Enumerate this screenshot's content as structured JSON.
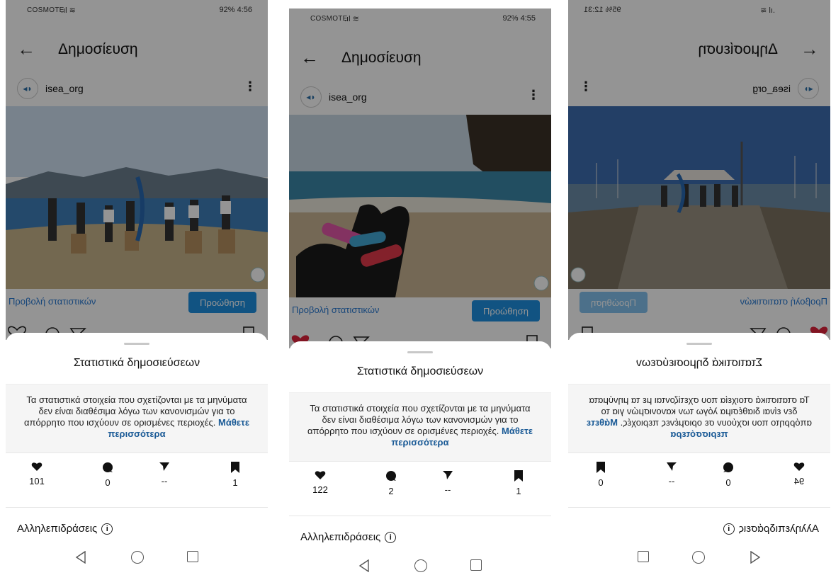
{
  "screens": [
    {
      "status": {
        "carrier": "COSMOTE",
        "right": "92% 4:56"
      },
      "appbar_title": "Δημοσίευση",
      "username": "isea_org",
      "view_stats": "Προβολή στατιστικών",
      "promote": "Προώθηση",
      "sheet_title": "Στατιστικά δημοσιεύσεων",
      "notice": "Τα στατιστικά στοιχεία που σχετίζονται με τα μηνύματα δεν είναι διαθέσιμα λόγω των κανονισμών για το απόρρητο που ισχύουν σε ορισμένες περιοχές.",
      "learn_more": "Μάθετε περισσότερα",
      "likes": "101",
      "comments": "0",
      "shares": "--",
      "saves": "1",
      "interactions": "Αλληλεπιδράσεις",
      "info_glyph": "i"
    },
    {
      "status": {
        "carrier": "COSMOTE",
        "right": "92% 4:55"
      },
      "appbar_title": "Δημοσίευση",
      "username": "isea_org",
      "view_stats": "Προβολή στατιστικών",
      "promote": "Προώθηση",
      "sheet_title": "Στατιστικά δημοσιεύσεων",
      "notice": "Τα στατιστικά στοιχεία που σχετίζονται με τα μηνύματα δεν είναι διαθέσιμα λόγω των κανονισμών για το απόρρητο που ισχύουν σε ορισμένες περιοχές.",
      "learn_more": "Μάθετε περισσότερα",
      "likes": "122",
      "comments": "2",
      "shares": "--",
      "saves": "1",
      "interactions": "Αλληλεπιδράσεις",
      "info_glyph": "i"
    },
    {
      "status": {
        "carrier": "",
        "right": "95% 12:31"
      },
      "appbar_title": "Δημοσίευση",
      "username": "isea_org",
      "view_stats": "Προβολή στατιστικών",
      "promote": "Προώθηση",
      "sheet_title": "Στατιστικά δημοσιεύσεων",
      "notice": "Τα στατιστικά στοιχεία που σχετίζονται με τα μηνύματα δεν είναι διαθέσιμα λόγω των κανονισμών για το απόρρητο που ισχύουν σε ορισμένες περιοχές.",
      "learn_more": "Μάθετε περισσότερα",
      "likes": "94",
      "comments": "0",
      "shares": "--",
      "saves": "0",
      "interactions": "Αλληλεπιδράσεις",
      "info_glyph": "i"
    }
  ],
  "colors": {
    "accent_blue": "#1e8fe1",
    "link_blue": "#2a7ad3",
    "learn_more": "#1a5a96",
    "liked_red": "#e0243c"
  },
  "icons": [
    "back-arrow-icon",
    "more-options-icon",
    "heart-icon",
    "comment-icon",
    "send-icon",
    "bookmark-icon",
    "info-icon",
    "nav-back-icon",
    "nav-home-icon",
    "nav-recent-icon"
  ]
}
